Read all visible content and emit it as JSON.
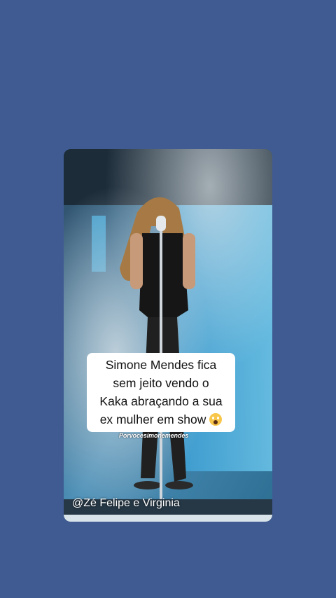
{
  "story": {
    "watermark": "Porvocesimonemendes",
    "caption_lines": [
      "Simone Mendes  fica",
      "sem jeito vendo o",
      "Kaka abraçando a sua",
      "ex mulher em show"
    ],
    "caption_emoji": "screaming-face-icon",
    "credit": "@Zé Felipe e Virginia"
  },
  "colors": {
    "background": "#3f5b92",
    "caption_bg": "#ffffff",
    "stage_blue": "#4fa7d6"
  }
}
